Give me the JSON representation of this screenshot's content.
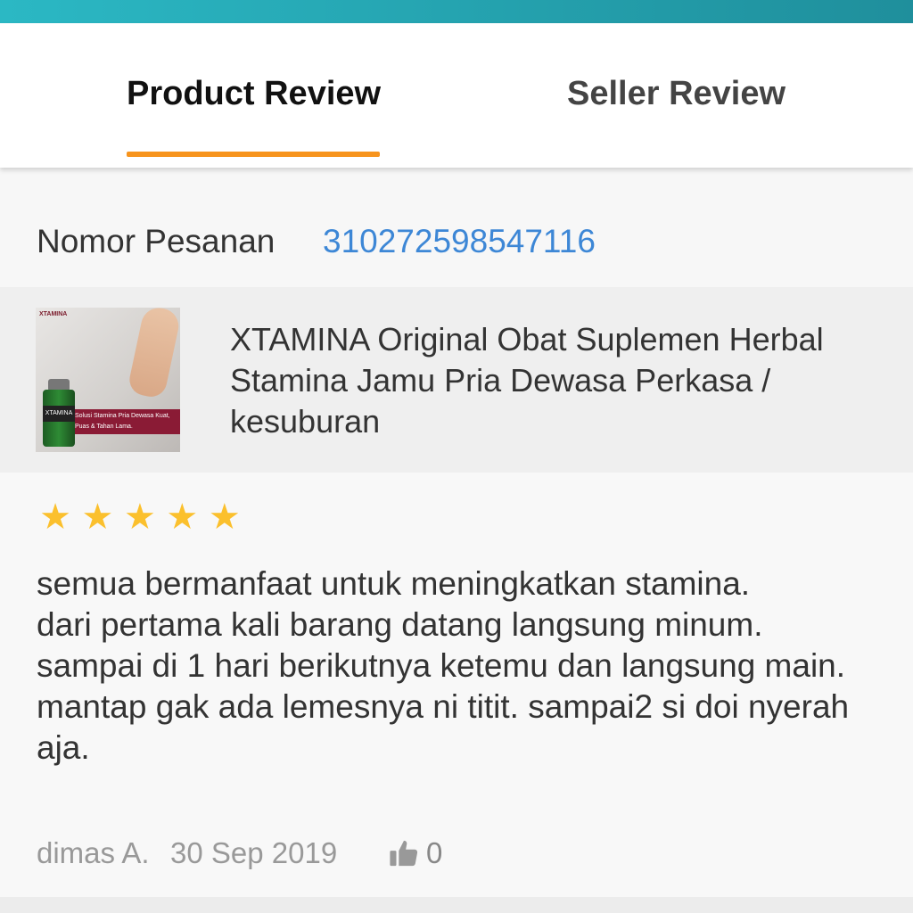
{
  "tabs": {
    "product_review": "Product Review",
    "seller_review": "Seller Review",
    "active": "product_review"
  },
  "order": {
    "label": "Nomor Pesanan",
    "number": "310272598547116"
  },
  "product": {
    "title": "XTAMINA Original Obat Suplemen Herbal Stamina Jamu Pria Dewasa Perkasa / kesuburan",
    "thumbnail": {
      "brand": "XTAMINA",
      "bottle_label": "XTAMINA",
      "tagline": "Solusi Stamina Pria Dewasa Kuat, Puas & Tahan Lama."
    }
  },
  "review": {
    "rating": 5,
    "stars": [
      "★",
      "★",
      "★",
      "★",
      "★"
    ],
    "text": "semua bermanfaat untuk meningkatkan stamina.\ndari pertama kali barang datang langsung minum.\nsampai di 1 hari berikutnya ketemu dan langsung main.\nmantap gak ada lemesnya ni titit. sampai2 si doi nyerah aja.",
    "reviewer": "dimas A.",
    "date": "30 Sep 2019",
    "likes": "0"
  },
  "colors": {
    "accent": "#f7941d",
    "link": "#3d87d6",
    "star": "#fbc02d",
    "header_gradient_start": "#2bb8c4",
    "header_gradient_end": "#1f8f9c"
  },
  "icons": {
    "like": "thumbs-up-icon",
    "star": "star-icon"
  }
}
